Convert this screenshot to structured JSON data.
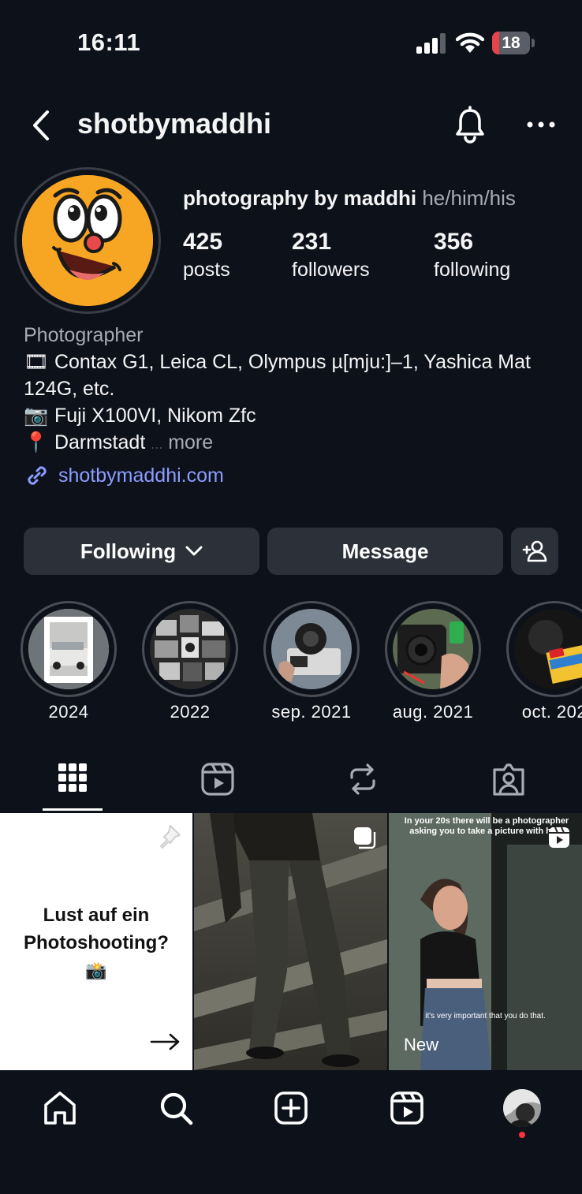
{
  "status_bar": {
    "time": "16:11",
    "battery_level": "18",
    "battery_fraction": 0.18,
    "battery_color": "#e8434a"
  },
  "header": {
    "username": "shotbymaddhi",
    "icons": [
      "back-chevron-icon",
      "bell-icon",
      "more-options-icon"
    ]
  },
  "profile": {
    "full_name": "photography by maddhi",
    "pronouns": "he/him/his",
    "stats": [
      {
        "value": "425",
        "label": "posts"
      },
      {
        "value": "231",
        "label": "followers"
      },
      {
        "value": "356",
        "label": "following"
      }
    ],
    "category": "Photographer",
    "bio": {
      "line1_emoji": "🎞",
      "line1": "Contax G1, Leica CL, Olympus µ[mju:]–1, Yashica Mat 124G, etc.",
      "line2_emoji": "📷",
      "line2": "Fuji X100VI, Nikom Zfc",
      "line3_emoji": "📍",
      "line3": "Darmstadt",
      "ellipsis": "...",
      "more": "more"
    },
    "link": "shotbymaddhi.com",
    "link_color": "#8c9cff"
  },
  "actions": {
    "following_label": "Following",
    "message_label": "Message"
  },
  "highlights": [
    {
      "label": "2024"
    },
    {
      "label": "2022"
    },
    {
      "label": "sep. 2021"
    },
    {
      "label": "aug. 2021"
    },
    {
      "label": "oct. 202"
    }
  ],
  "tabs": [
    "grid-icon",
    "reels-icon",
    "reposts-icon",
    "tagged-icon"
  ],
  "posts": {
    "post1": {
      "title_line1": "Lust auf ein",
      "title_line2": "Photoshooting?",
      "emoji": "📸"
    },
    "post3": {
      "overlay_top": "In your 20s there will be a photographer asking you to take a picture with him.",
      "overlay_mid": "it's very important that you do that.",
      "badge": "New"
    }
  },
  "bottom_nav": [
    "home-icon",
    "search-icon",
    "create-icon",
    "reels-icon",
    "profile-avatar"
  ]
}
